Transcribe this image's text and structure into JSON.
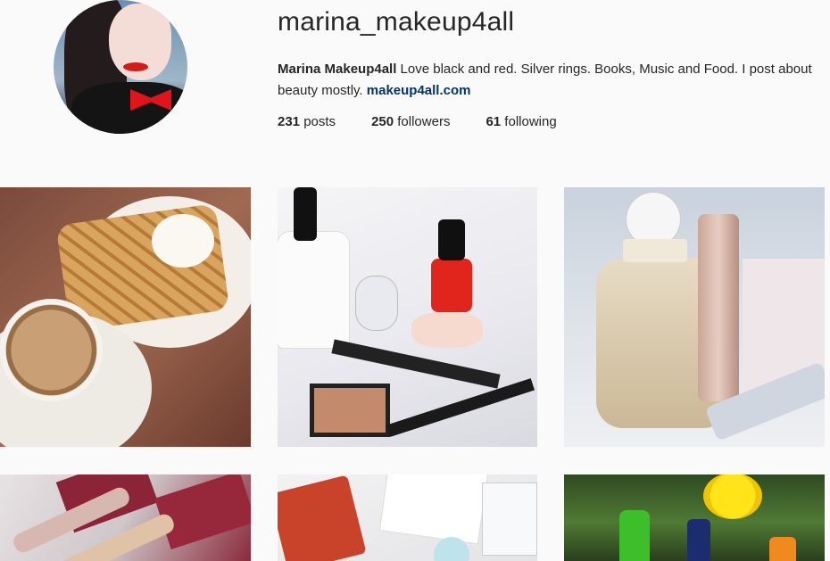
{
  "profile": {
    "username": "marina_makeup4all",
    "display_name": "Marina Makeup4all",
    "bio_text": " Love black and red. Silver rings. Books, Music and Food. I post about beauty mostly. ",
    "website": "makeup4all.com"
  },
  "stats": {
    "posts_count": "231",
    "posts_label": " posts",
    "followers_count": "250",
    "followers_label": " followers",
    "following_count": "61",
    "following_label": " following"
  },
  "posts": [
    {
      "subject": "waffles-and-coffee"
    },
    {
      "subject": "makeup-products"
    },
    {
      "subject": "balenciaga-perfume"
    },
    {
      "subject": "lip-glosses"
    },
    {
      "subject": "skincare-samples"
    },
    {
      "subject": "bottles-in-grass"
    }
  ]
}
